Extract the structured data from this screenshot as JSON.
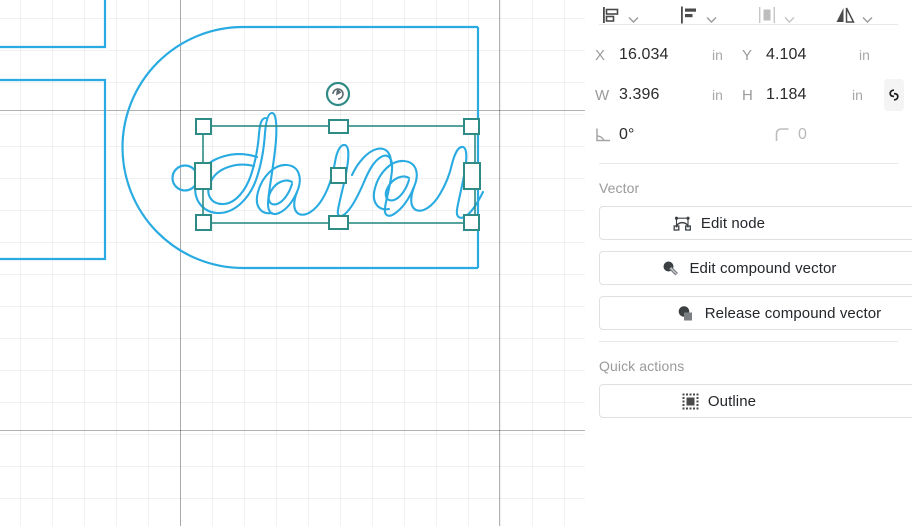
{
  "canvas": {
    "artwork_text": "dana",
    "stroke_color": "#29abe2",
    "selection_color": "#2e8b86",
    "grid_minor_color": "#e8e8e8",
    "grid_major_color": "#b0b0b0",
    "objects": [
      {
        "name": "keychain-tag-outline",
        "type": "rounded-tag"
      },
      {
        "name": "hole-circle",
        "type": "circle"
      },
      {
        "name": "script-text-dana",
        "type": "text-outline"
      },
      {
        "name": "rectangle-partial-top",
        "type": "rect"
      },
      {
        "name": "rectangle-partial-bottom",
        "type": "rect"
      }
    ]
  },
  "align_toolbar": {
    "items": [
      {
        "name": "align-objects",
        "icon": "align-left-icon",
        "has_chevron": true
      },
      {
        "name": "align-text",
        "icon": "align-text-left-icon",
        "has_chevron": true
      },
      {
        "name": "distribute",
        "icon": "distribute-horizontal-icon",
        "has_chevron": true
      },
      {
        "name": "flip",
        "icon": "flip-horizontal-icon",
        "has_chevron": true
      }
    ],
    "chevron_glyph": "⌄"
  },
  "transform": {
    "x": {
      "label": "X",
      "value": "16.034",
      "unit": "in"
    },
    "y": {
      "label": "Y",
      "value": "4.104",
      "unit": "in"
    },
    "w": {
      "label": "W",
      "value": "3.396",
      "unit": "in"
    },
    "h": {
      "label": "H",
      "value": "1.184",
      "unit": "in"
    },
    "angle": {
      "label": "angle-icon",
      "value": "0°"
    },
    "corner_radius": {
      "label": "corner-radius-icon",
      "value": "0"
    },
    "lock_aspect": {
      "name": "lock-aspect-ratio",
      "icon": "link-chain-icon"
    }
  },
  "vector": {
    "title": "Vector",
    "buttons": [
      {
        "label": "Edit node",
        "icon": "edit-node-icon"
      },
      {
        "label": "Edit compound vector",
        "icon": "edit-compound-vector-icon"
      },
      {
        "label": "Release compound vector",
        "icon": "release-compound-vector-icon"
      }
    ]
  },
  "quick_actions": {
    "title": "Quick actions",
    "buttons": [
      {
        "label": "Outline",
        "icon": "outline-icon"
      }
    ]
  }
}
